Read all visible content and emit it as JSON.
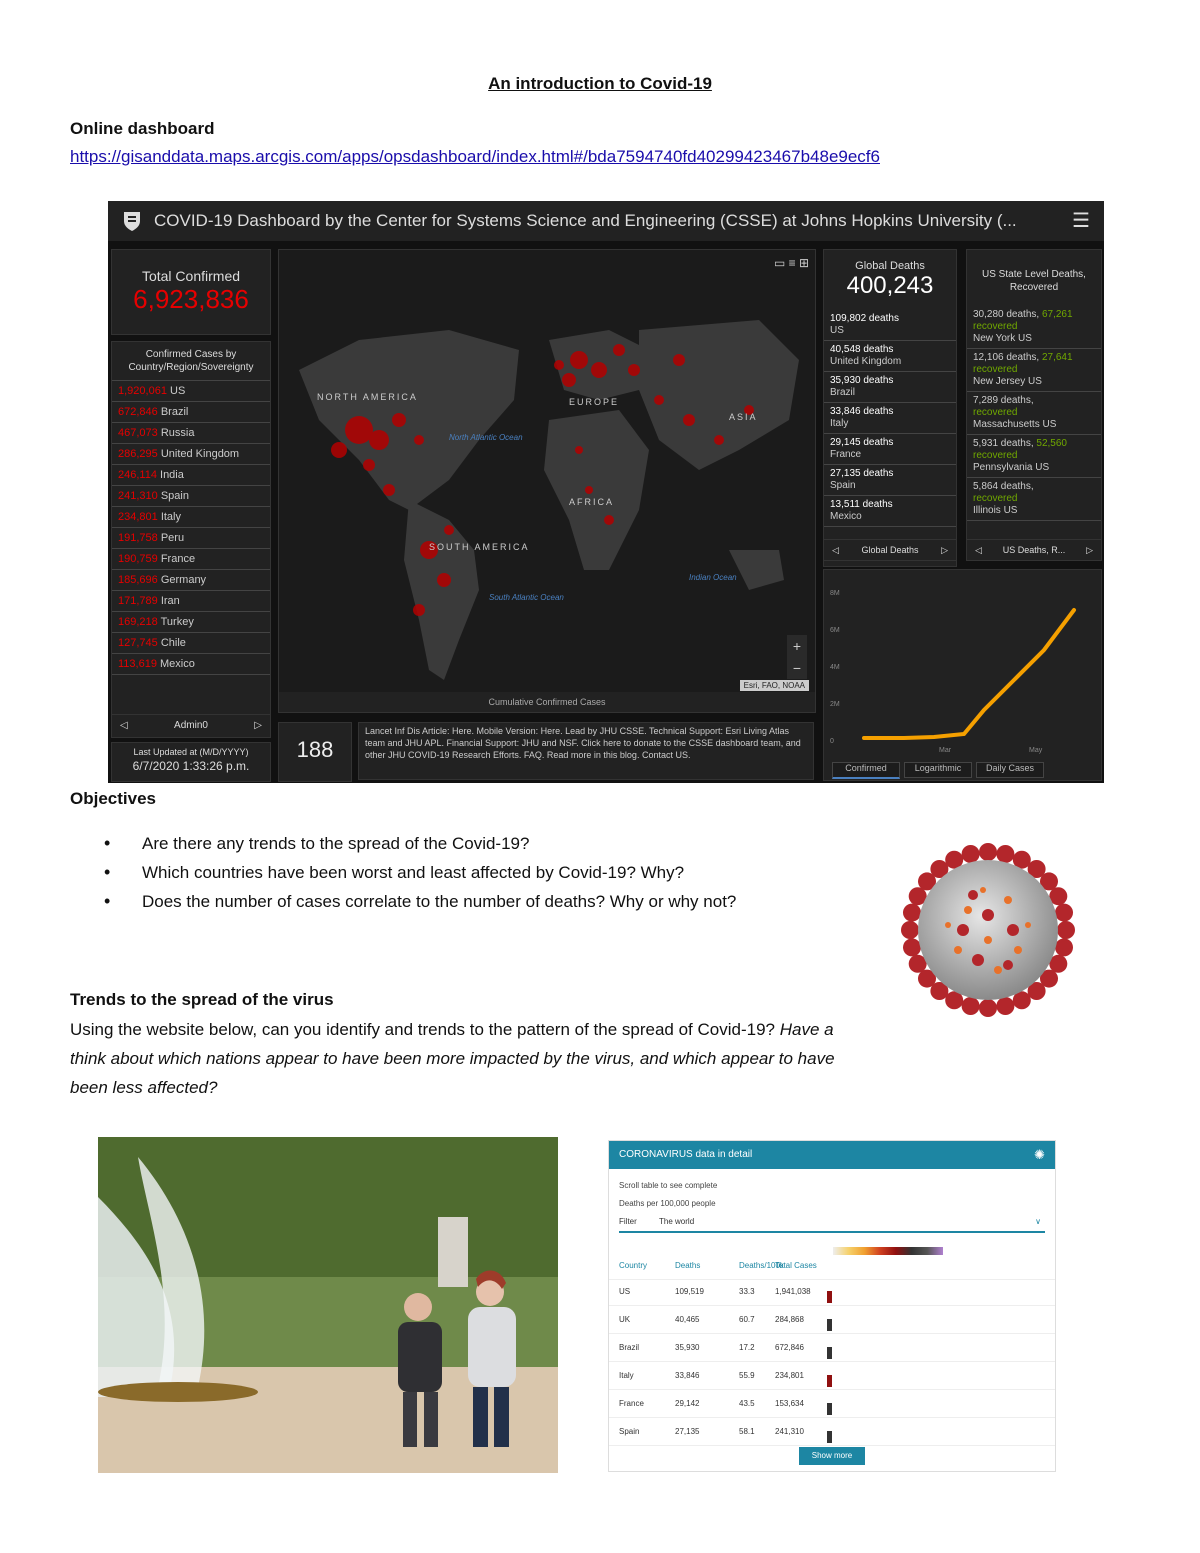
{
  "doc": {
    "title": "An introduction to Covid-19",
    "online_heading": "Online dashboard",
    "url": "https://gisanddata.maps.arcgis.com/apps/opsdashboard/index.html#/bda7594740fd40299423467b48e9ecf6",
    "objectives_heading": "Objectives",
    "objectives": [
      "Are there any trends to the spread of the Covid-19?",
      "Which countries have been worst and least affected by Covid-19? Why?",
      "Does the number of cases correlate to the number of deaths? Why or why not?"
    ],
    "trends_heading": "Trends to the spread of the virus",
    "trends_text_normal": "Using the website below, can you identify and trends to the pattern of the spread of Covid-19?",
    "trends_text_italic": "Have a think about which nations appear to have been more impacted by the virus, and which appear to have been less affected?"
  },
  "dashboard": {
    "header_title": "COVID-19 Dashboard by the Center for Systems Science and Engineering (CSSE) at Johns Hopkins University (...",
    "total_label": "Total Confirmed",
    "total_value": "6,923,836",
    "cases_by_heading": "Confirmed Cases by Country/Region/Sovereignty",
    "countries": [
      {
        "n": "1,920,061",
        "c": "US"
      },
      {
        "n": "672,846",
        "c": "Brazil"
      },
      {
        "n": "467,073",
        "c": "Russia"
      },
      {
        "n": "286,295",
        "c": "United Kingdom"
      },
      {
        "n": "246,114",
        "c": "India"
      },
      {
        "n": "241,310",
        "c": "Spain"
      },
      {
        "n": "234,801",
        "c": "Italy"
      },
      {
        "n": "191,758",
        "c": "Peru"
      },
      {
        "n": "190,759",
        "c": "France"
      },
      {
        "n": "185,696",
        "c": "Germany"
      },
      {
        "n": "171,789",
        "c": "Iran"
      },
      {
        "n": "169,218",
        "c": "Turkey"
      },
      {
        "n": "127,745",
        "c": "Chile"
      },
      {
        "n": "113,619",
        "c": "Mexico"
      }
    ],
    "admin_nav": "Admin0",
    "last_updated_label": "Last Updated at (M/D/YYYY)",
    "last_updated_value": "6/7/2020 1:33:26 p.m.",
    "count_value": "188",
    "map_labels": {
      "north_america": "NORTH AMERICA",
      "south_america": "SOUTH AMERICA",
      "europe": "EUROPE",
      "africa": "AFRICA",
      "asia": "ASIA",
      "north_atlantic": "North Atlantic Ocean",
      "south_atlantic": "South Atlantic Ocean",
      "indian": "Indian Ocean",
      "attribution": "Esri, FAO, NOAA",
      "map_caption": "Cumulative Confirmed Cases"
    },
    "info_text": "Lancet Inf Dis Article: Here. Mobile Version: Here. Lead by JHU CSSE. Technical Support: Esri Living Atlas team and JHU APL. Financial Support: JHU and NSF. Click here to donate to the CSSE dashboard team, and other JHU COVID-19 Research Efforts. FAQ. Read more in this blog. Contact US.",
    "global_deaths_label": "Global Deaths",
    "global_deaths_value": "400,243",
    "deaths": [
      {
        "v": "109,802 deaths",
        "c": "US"
      },
      {
        "v": "40,548 deaths",
        "c": "United Kingdom"
      },
      {
        "v": "35,930 deaths",
        "c": "Brazil"
      },
      {
        "v": "33,846 deaths",
        "c": "Italy"
      },
      {
        "v": "29,145 deaths",
        "c": "France"
      },
      {
        "v": "27,135 deaths",
        "c": "Spain"
      },
      {
        "v": "13,511 deaths",
        "c": "Mexico"
      }
    ],
    "global_deaths_nav": "Global Deaths",
    "us_state_label": "US State Level Deaths, Recovered",
    "us_states": [
      {
        "d": "30,280 deaths,",
        "r": "67,261",
        "rl": "recovered",
        "s": "New York US"
      },
      {
        "d": "12,106 deaths,",
        "r": "27,641",
        "rl": "recovered",
        "s": "New Jersey US"
      },
      {
        "d": "7,289 deaths,",
        "r": "",
        "rl": "recovered",
        "s": "Massachusetts US"
      },
      {
        "d": "5,931 deaths,",
        "r": "52,560",
        "rl": "recovered",
        "s": "Pennsylvania US"
      },
      {
        "d": "5,864 deaths,",
        "r": "",
        "rl": "recovered",
        "s": "Illinois US"
      }
    ],
    "us_nav": "US Deaths, R...",
    "chart_tabs": [
      "Confirmed",
      "Logarithmic",
      "Daily Cases"
    ],
    "chart_xticks": [
      "Mar",
      "May"
    ],
    "chart_yticks": [
      "0",
      "2M",
      "4M",
      "6M",
      "8M"
    ]
  },
  "table_image": {
    "header": "CORONAVIRUS data in detail",
    "sub1": "Scroll table to see complete",
    "sub2": "Deaths per 100,000 people",
    "filter_label": "Filter",
    "filter_value": "The world",
    "columns": [
      "Country",
      "Deaths",
      "Deaths/100k",
      "Total Cases"
    ],
    "rows": [
      [
        "US",
        "109,519",
        "33.3",
        "1,941,038"
      ],
      [
        "UK",
        "40,465",
        "60.7",
        "284,868"
      ],
      [
        "Brazil",
        "35,930",
        "17.2",
        "672,846"
      ],
      [
        "Italy",
        "33,846",
        "55.9",
        "234,801"
      ],
      [
        "France",
        "29,142",
        "43.5",
        "153,634"
      ],
      [
        "Spain",
        "27,135",
        "58.1",
        "241,310"
      ]
    ],
    "button": "Show more"
  },
  "colors": {
    "dashboard_bg": "#111111",
    "dashboard_red": "#e60000",
    "chart_line": "#f5a000",
    "table_teal": "#1d86a3",
    "link_blue": "#1a0dab"
  }
}
